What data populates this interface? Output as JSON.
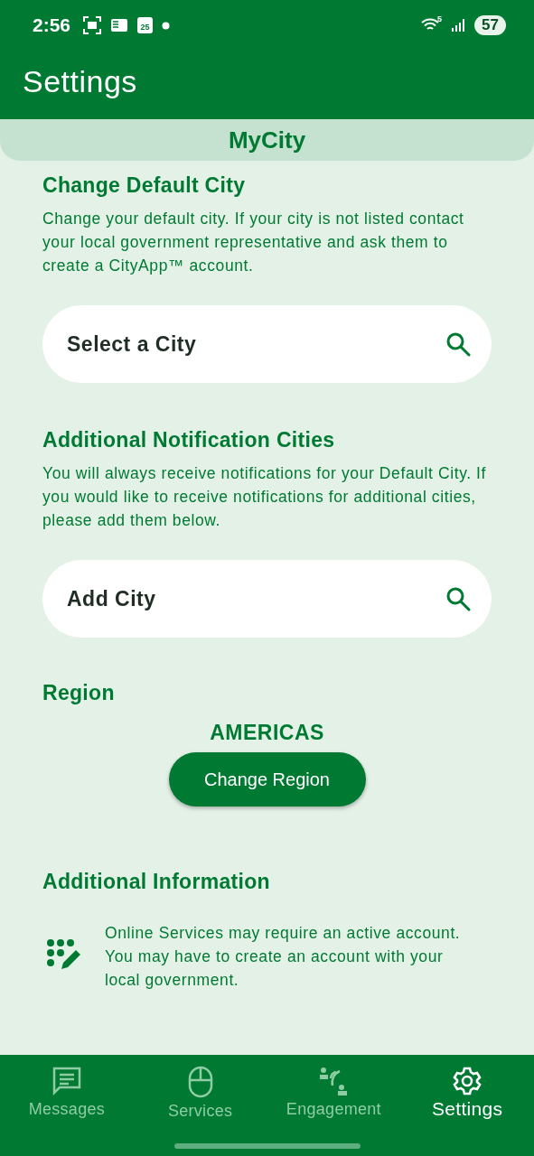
{
  "status_bar": {
    "time": "2:56",
    "calendar_day": "25",
    "network_label": "5",
    "battery": "57"
  },
  "app_bar": {
    "title": "Settings"
  },
  "section_tab": {
    "label": "MyCity"
  },
  "default_city": {
    "heading": "Change Default City",
    "description": "Change your default city. If your city is not listed contact your local government representative and ask them to create a CityApp™ account.",
    "search": {
      "placeholder": "Select a City"
    }
  },
  "notification_cities": {
    "heading": "Additional Notification Cities",
    "description": "You will always receive notifications for your Default City. If you would like to receive notifications for additional cities, please add them below.",
    "search": {
      "placeholder": "Add City"
    }
  },
  "region": {
    "heading": "Region",
    "value": "AMERICAS",
    "button": "Change Region"
  },
  "additional_information": {
    "heading": "Additional Information",
    "text": "Online Services may require an active account. You may have to create an account with your local government."
  },
  "bottom_nav": [
    {
      "label": "Messages",
      "selected": false
    },
    {
      "label": "Services",
      "selected": false
    },
    {
      "label": "Engagement",
      "selected": false
    },
    {
      "label": "Settings",
      "selected": true
    }
  ]
}
